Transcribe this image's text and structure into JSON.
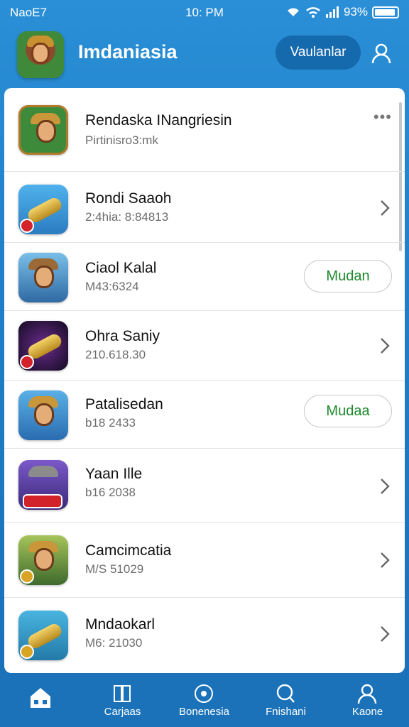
{
  "status": {
    "carrier": "NaoE7",
    "time": "10: PM",
    "battery": "93%"
  },
  "header": {
    "title": "Imdaniasia",
    "button_label": "Vaulanlar"
  },
  "list": {
    "featured": {
      "title": "Rendaska INangriesin",
      "subtitle": "Pirtinisro3:mk"
    },
    "items": [
      {
        "title": "Rondi Saaoh",
        "subtitle": "2:4hia: 8:84813"
      },
      {
        "title": "Ciaol Kalal",
        "subtitle": "M43:6324",
        "action": "Mudan"
      },
      {
        "title": "Ohra Saniy",
        "subtitle": "210.618.30"
      },
      {
        "title": "Patalisedan",
        "subtitle": "b18 2433",
        "action": "Mudaa"
      },
      {
        "title": "Yaan Ille",
        "subtitle": "b16 2038"
      },
      {
        "title": "Camcimcatia",
        "subtitle": "M/S 51029"
      },
      {
        "title": "Mndaokarl",
        "subtitle": "M6: 21030"
      }
    ]
  },
  "nav": [
    {
      "label": ""
    },
    {
      "label": "Carjaas"
    },
    {
      "label": "Bonenesia"
    },
    {
      "label": "Fnishani"
    },
    {
      "label": "Kaone"
    }
  ],
  "colors": {
    "primary": "#1f7fc8",
    "action_green": "#1d8a2c"
  }
}
